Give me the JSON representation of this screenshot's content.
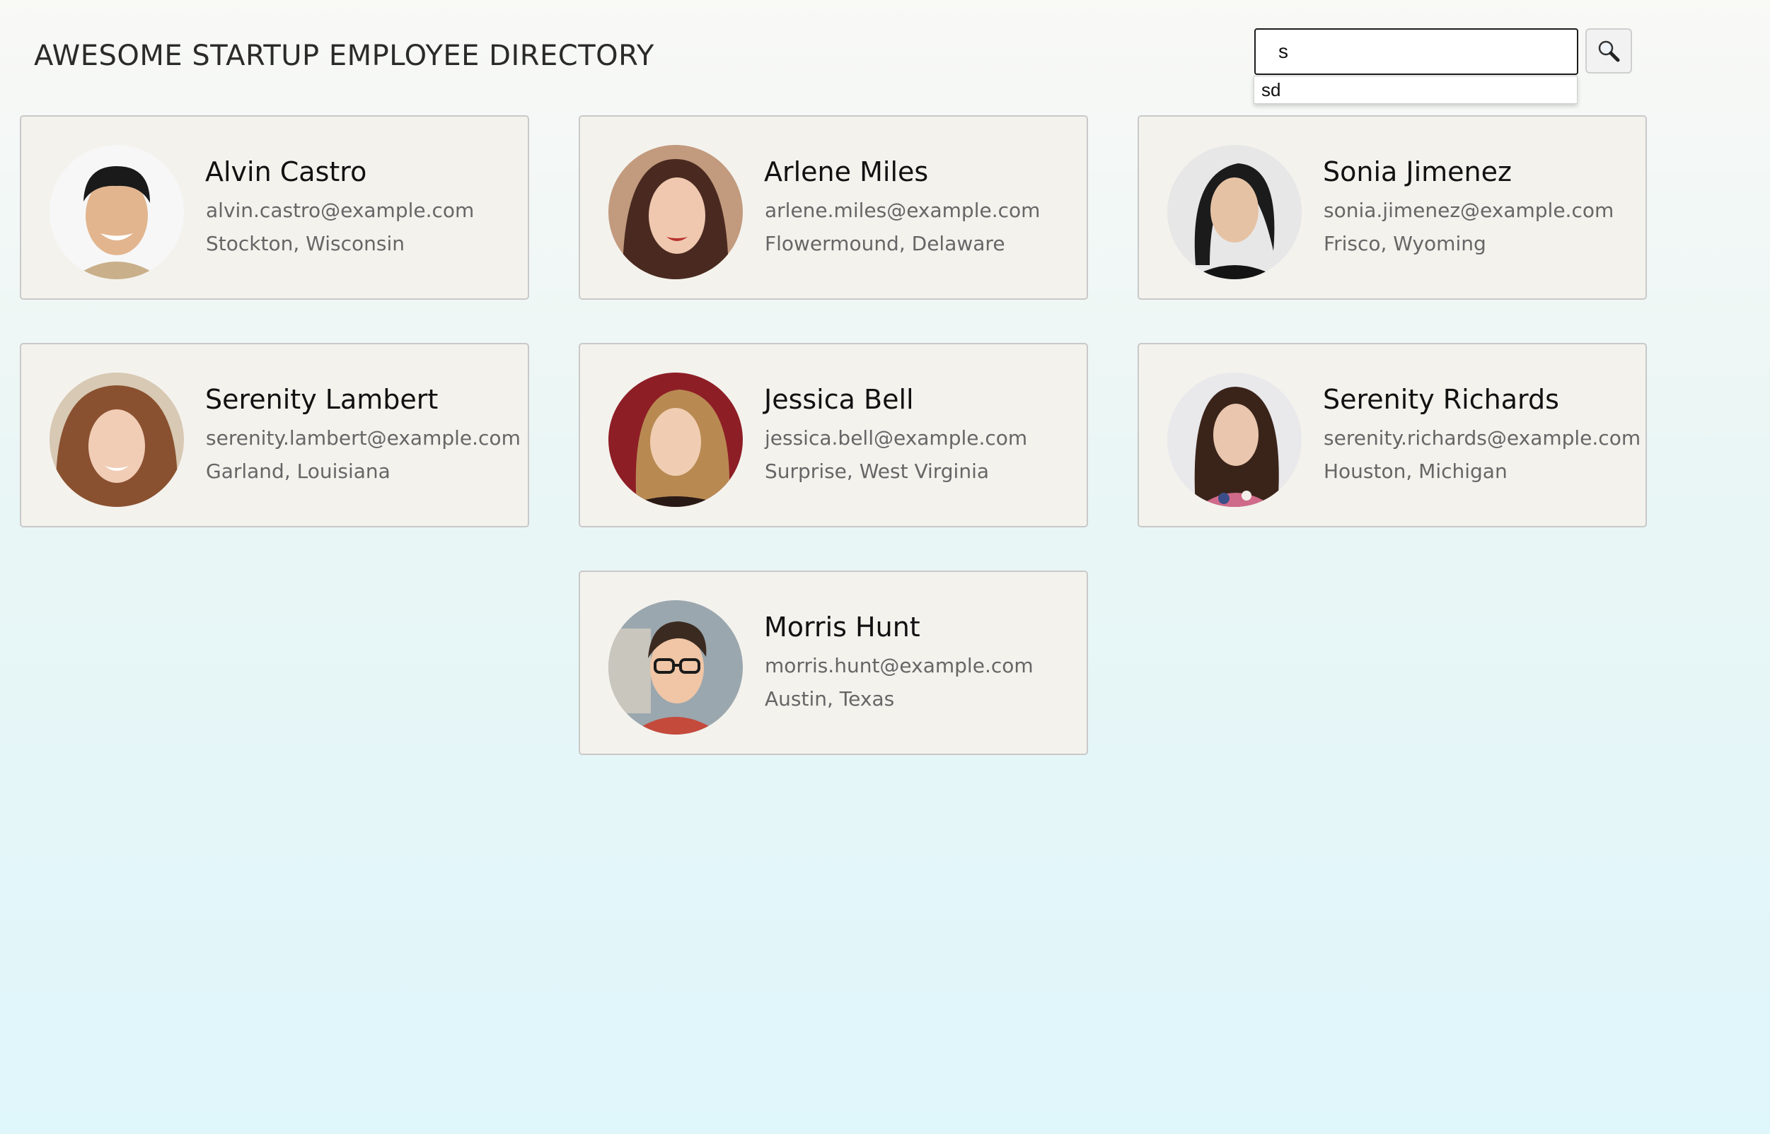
{
  "header": {
    "title": "AWESOME STARTUP EMPLOYEE DIRECTORY"
  },
  "search": {
    "value": "s",
    "button_icon": "magnifier-icon",
    "suggestions": [
      "sd"
    ]
  },
  "employees": [
    {
      "name": "Alvin Castro",
      "email": "alvin.castro@example.com",
      "location": "Stockton, Wisconsin"
    },
    {
      "name": "Arlene Miles",
      "email": "arlene.miles@example.com",
      "location": "Flowermound, Delaware"
    },
    {
      "name": "Sonia Jimenez",
      "email": "sonia.jimenez@example.com",
      "location": "Frisco, Wyoming"
    },
    {
      "name": "Serenity Lambert",
      "email": "serenity.lambert@example.com",
      "location": "Garland, Louisiana"
    },
    {
      "name": "Jessica Bell",
      "email": "jessica.bell@example.com",
      "location": "Surprise, West Virginia"
    },
    {
      "name": "Serenity Richards",
      "email": "serenity.richards@example.com",
      "location": "Houston, Michigan"
    },
    {
      "name": "Morris Hunt",
      "email": "morris.hunt@example.com",
      "location": "Austin, Texas"
    }
  ]
}
